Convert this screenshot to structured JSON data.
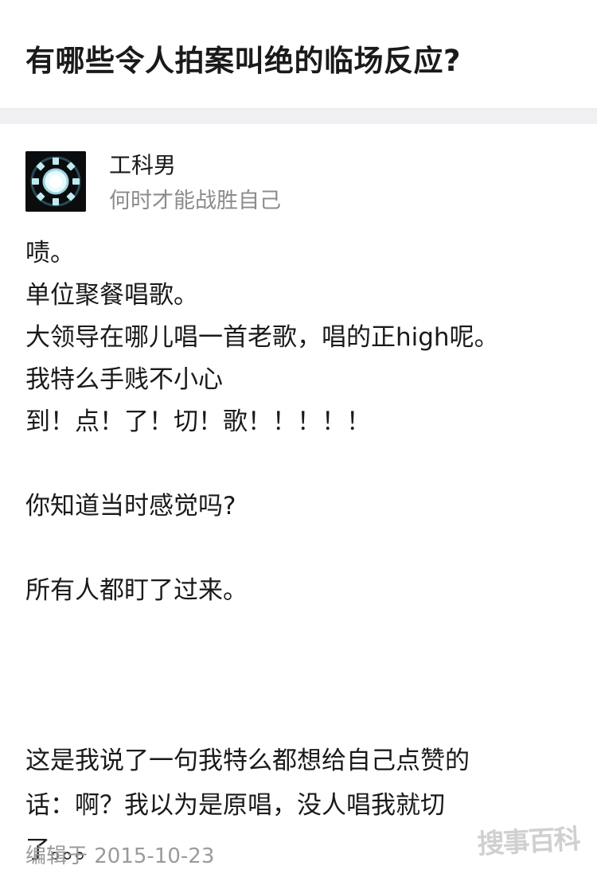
{
  "question": {
    "title": "有哪些令人拍案叫绝的临场反应?"
  },
  "author": {
    "name": "工科男",
    "bio": "何时才能战胜自己",
    "avatar_icon": "arc-reactor-icon"
  },
  "answer": {
    "lines": [
      "啧。",
      "单位聚餐唱歌。",
      "大领导在哪儿唱一首老歌，唱的正high呢。",
      "我特么手贱不小心",
      "到！点！了！切！歌！！！！！",
      "",
      "你知道当时感觉吗?",
      "",
      "所有人都盯了过来。",
      "",
      "",
      "这是我说了一句我特么都想给自己点赞的",
      "话：啊？我以为是原唱，没人唱我就切",
      "了。。。"
    ]
  },
  "footer": {
    "edit_time": "编辑于 2015-10-23"
  },
  "watermark": {
    "text": "搜事百科"
  },
  "colors": {
    "text_primary": "#1a1a1a",
    "text_secondary": "#8c8c8c",
    "divider": "#f0f0f2",
    "avatar_bg": "#0b0c0e",
    "avatar_glow": "#bfeaf2"
  }
}
